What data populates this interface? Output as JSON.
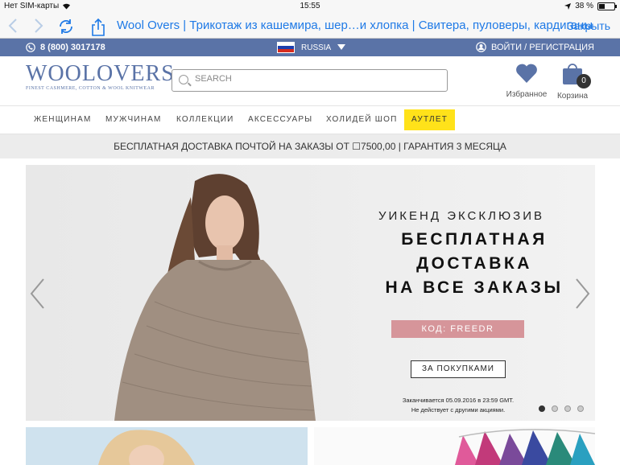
{
  "status_bar": {
    "carrier": "Нет SIM-карты",
    "time": "15:55",
    "battery": "38 %",
    "battery_level": 0.38
  },
  "browser": {
    "back_icon": "chevron-left-icon",
    "forward_icon": "chevron-right-icon",
    "reload_icon": "reload-icon",
    "share_icon": "share-icon",
    "page_title": "Wool Overs | Трикотаж из кашемира, шер…и хлопка | Свитера, пуловеры, кардиганы",
    "close_label": "Закрыть"
  },
  "infobar": {
    "phone": "8 (800) 3017178",
    "country": "RUSSIA",
    "login": "ВОЙТИ / РЕГИСТРАЦИЯ"
  },
  "header": {
    "logo_main": "WOOLOVERS",
    "logo_sub": "FINEST CASHMERE, COTTON & WOOL KNITWEAR",
    "search_placeholder": "SEARCH",
    "favorites_label": "Избранное",
    "cart_label": "Корзина",
    "cart_count": "0",
    "brand_color": "#5a73a7"
  },
  "menu": {
    "items": [
      "ЖЕНЩИНАМ",
      "МУЖЧИНАМ",
      "КОЛЛЕКЦИИ",
      "АКСЕССУАРЫ",
      "ХОЛИДЕЙ ШОП"
    ],
    "outlet": "АУТЛЕТ",
    "outlet_color": "#ffe21a"
  },
  "promo": {
    "text": "БЕСПЛАТНАЯ ДОСТАВКА ПОЧТОЙ НА ЗАКАЗЫ ОТ ☐7500,00   |   ГАРАНТИЯ 3 МЕСЯЦА"
  },
  "hero": {
    "subtitle": "УИКЕНД ЭКСКЛЮЗИВ",
    "line1": "БЕСПЛАТНАЯ",
    "line2": "ДОСТАВКА",
    "line3": "НА ВСЕ ЗАКАЗЫ",
    "code": "КОД: FREEDR",
    "cta": "ЗА ПОКУПКАМИ",
    "fine1": "Заканчивается 05.09.2016 в 23:59 GMT.",
    "fine2": "Не действует с другими акциями.",
    "code_color": "#d6959a",
    "slide_count": 4,
    "active_slide": 1
  }
}
